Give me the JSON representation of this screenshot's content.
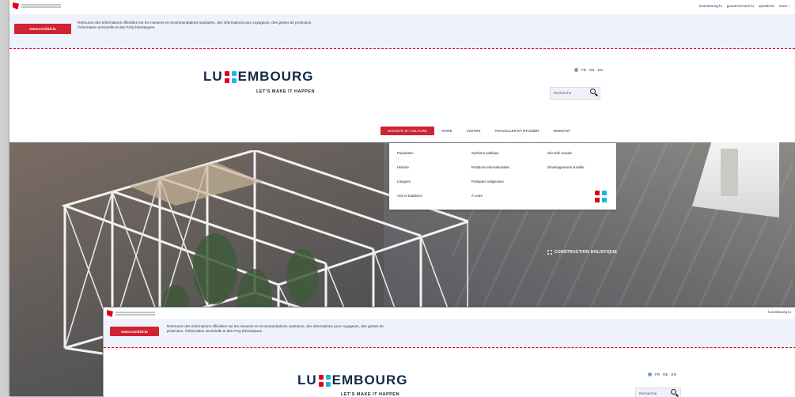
{
  "gov": {
    "logo_alt": "Le Gouvernement du Grand-Duché de Luxembourg"
  },
  "top_links": [
    "luxembourg.lu",
    "gouvernement.lu",
    "questions",
    "more..."
  ],
  "alert": {
    "button": "www.covid19.lu",
    "text": "Retrouvez des informations officielles sur les mesures et recommandations sanitaires, des informations pour voyageurs, des gestes de protection, l'information sectorielle et des FAQ thématiques."
  },
  "brand": {
    "logo_left": "LU",
    "logo_right": "EMBOURG",
    "tagline": "LET'S MAKE IT HAPPEN"
  },
  "lang": [
    "FR",
    "DE",
    "EN"
  ],
  "search": {
    "placeholder": "Recherche"
  },
  "nav": [
    "SOCIÉTÉ ET CULTURE",
    "VIVRE",
    "VISITER",
    "TRAVAILLER ET ÉTUDIER",
    "INVESTIR"
  ],
  "dropdown": {
    "col1": [
      "Population",
      "Histoire",
      "Langues",
      "Arts et traditions"
    ],
    "col2": [
      "Système politique",
      "Relations internationales",
      "Pratiques religieuses",
      "À votre"
    ],
    "col3": [
      "Sécurité sociale",
      "Développement durable"
    ]
  },
  "hero": {
    "caption": "CONSTRUCTION HOLISTIQUE"
  },
  "colors": {
    "accent": "#cf2232",
    "navy": "#112a46",
    "alert_bg": "#eef3fb"
  }
}
